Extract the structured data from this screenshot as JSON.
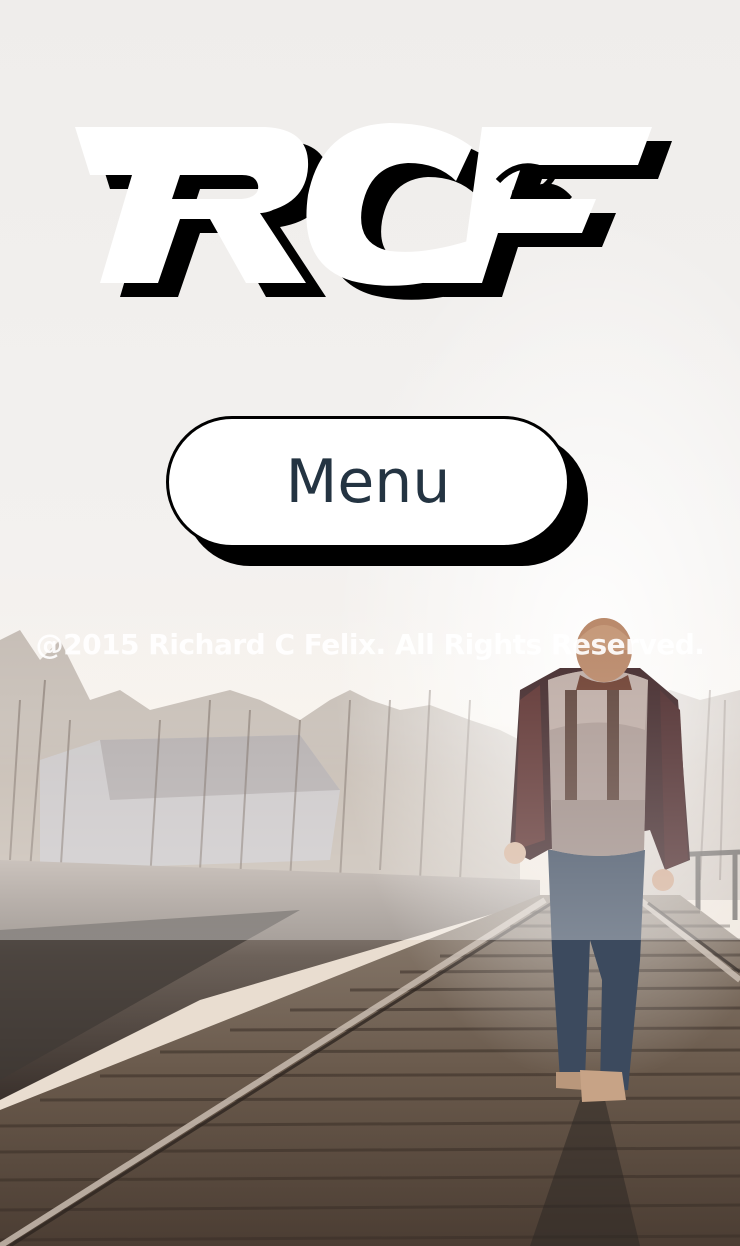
{
  "logo": {
    "text": "RCF",
    "alt": "RCF"
  },
  "menu_button": {
    "label": "Menu"
  },
  "footer": {
    "copyright": "@2015 Richard C Felix. All Rights Reserved."
  },
  "colors": {
    "background_sky": "#f1efed",
    "button_fill": "#ffffff",
    "button_text": "#243442",
    "button_shadow": "#000000",
    "logo_fill": "#ffffff",
    "logo_shadow": "#000000",
    "copyright_text": "#ffffff"
  },
  "background_image": {
    "icon": "photo-person-walking-on-railroad-bridge"
  }
}
